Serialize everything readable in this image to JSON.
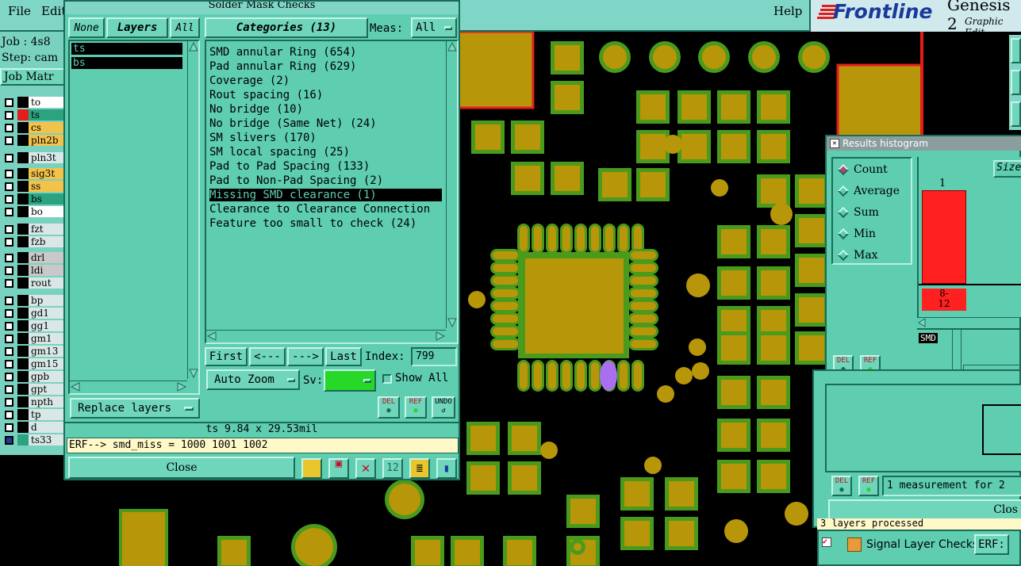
{
  "menubar": {
    "file": "File",
    "edit": "Edit",
    "help": "Help",
    "brand": "Frontline",
    "product": "Genesis 2",
    "product_sub": "Graphic Edit"
  },
  "job": {
    "job_line": "Job : 4s8",
    "step_line": "Step: cam",
    "matrix_label": "Job Matr"
  },
  "layers": [
    {
      "name": "to",
      "color": "#ffffff"
    },
    {
      "name": "ts",
      "color": "#2ba37e"
    },
    {
      "name": "cs",
      "color": "#f2c24a"
    },
    {
      "name": "pln2b",
      "color": "#f2c24a"
    },
    {
      "name": "pln3t",
      "color": "#d9e8e6"
    },
    {
      "name": "sig3t",
      "color": "#f2c24a"
    },
    {
      "name": "ss",
      "color": "#f2c24a"
    },
    {
      "name": "bs",
      "color": "#2ba37e"
    },
    {
      "name": "bo",
      "color": "#ffffff"
    },
    {
      "name": "fzt",
      "color": "#d9e8e6"
    },
    {
      "name": "fzb",
      "color": "#d9e8e6"
    },
    {
      "name": "drl",
      "color": "#c9c9c9"
    },
    {
      "name": "ldi",
      "color": "#c9c9c9"
    },
    {
      "name": "rout",
      "color": "#d9e8e6"
    },
    {
      "name": "bp",
      "color": "#d9e8e6"
    },
    {
      "name": "gd1",
      "color": "#d9e8e6"
    },
    {
      "name": "gg1",
      "color": "#d9e8e6"
    },
    {
      "name": "gm1",
      "color": "#d9e8e6"
    },
    {
      "name": "gm13",
      "color": "#d9e8e6"
    },
    {
      "name": "gm15",
      "color": "#d9e8e6"
    },
    {
      "name": "gpb",
      "color": "#d9e8e6"
    },
    {
      "name": "gpt",
      "color": "#d9e8e6"
    },
    {
      "name": "npth",
      "color": "#d9e8e6"
    },
    {
      "name": "tp",
      "color": "#d9e8e6"
    },
    {
      "name": "d",
      "color": "#d9e8e6"
    },
    {
      "name": "ts33",
      "color": "#d9e8e6"
    }
  ],
  "smw": {
    "title": "Solder Mask Checks",
    "none_label": "None",
    "layers_label": "Layers",
    "all_label": "All",
    "layer_list": [
      "ts",
      "bs"
    ],
    "categories_label": "Categories (13)",
    "meas_label": "Meas:",
    "meas_value": "All",
    "categories": [
      "SMD annular Ring (654)",
      "Pad annular Ring (629)",
      "Coverage (2)",
      "Rout spacing (16)",
      "No bridge (10)",
      "No bridge (Same Net) (24)",
      "SM slivers (170)",
      "SM local spacing (25)",
      "Pad to Pad Spacing (133)",
      "Pad to Non-Pad Spacing (2)",
      "Missing SMD clearance (1)",
      "Clearance to Clearance Connection",
      "Feature too small to check (24)"
    ],
    "selected_index": 10,
    "first": "First",
    "prev": "<---",
    "next": "--->",
    "last": "Last",
    "index_label": "Index:",
    "index_value": "799",
    "auto_zoom": "Auto Zoom",
    "sv_label": "Sv:",
    "show_all": "Show All",
    "replace_layers": "Replace layers",
    "del": "DEL",
    "ref": "REF",
    "undo": "UNDO",
    "status": "ts 9.84 x 29.53mil",
    "erf": "ERF--> smd_miss = 1000 1001 1002",
    "close": "Close"
  },
  "hist": {
    "title": "Results histogram",
    "options": [
      "Count",
      "Average",
      "Sum",
      "Min",
      "Max"
    ],
    "selected": "Count",
    "size_label": "Size",
    "bar_count": "1",
    "bar_range": "8-\n12",
    "smd_label": "SMD",
    "del": "DEL",
    "ref": "REF",
    "measurement_text": "1 measurement for 2",
    "close": "Clos",
    "processed": "3 layers processed"
  },
  "signal": {
    "title": "Signal Layer Checks",
    "erf": "ERF:"
  },
  "colors": {
    "panel": "#5ecdb0",
    "pad": "#b8960a",
    "mask": "#4a9a1c",
    "selected": "#a870ee",
    "bar": "#ff2020"
  }
}
